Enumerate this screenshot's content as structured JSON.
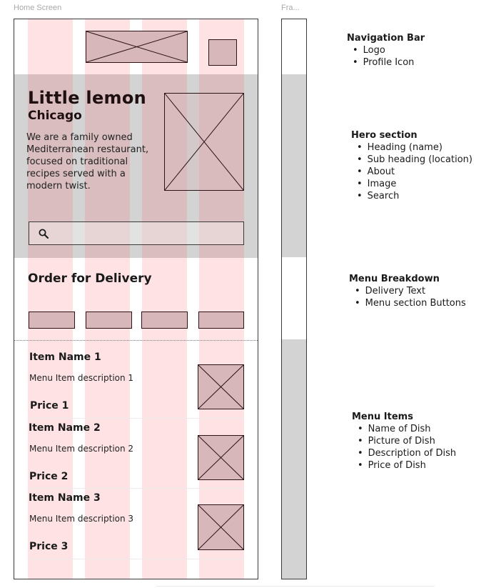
{
  "frames": {
    "home_label": "Home Screen",
    "second_label": "Fra..."
  },
  "hero": {
    "title": "Little lemon",
    "subtitle": "Chicago",
    "about": "We are a family owned Mediterranean restaurant, focused on traditional recipes served with a modern twist.",
    "search_icon": "search-icon"
  },
  "order": {
    "title": "Order for Delivery",
    "button_count_visible": 4
  },
  "menu_items": [
    {
      "name": "Item Name 1",
      "description": "Menu Item description 1",
      "price": "Price 1"
    },
    {
      "name": "Item Name 2",
      "description": "Menu Item description 2",
      "price": "Price 2"
    },
    {
      "name": "Item Name 3",
      "description": "Menu Item description 3",
      "price": "Price 3"
    }
  ],
  "annotations": [
    {
      "heading": "Navigation Bar",
      "items": [
        "Logo",
        "Profile Icon"
      ]
    },
    {
      "heading": "Hero section",
      "items": [
        "Heading (name)",
        "Sub heading (location)",
        "About",
        "Image",
        "Search"
      ]
    },
    {
      "heading": "Menu Breakdown",
      "items": [
        "Delivery Text",
        "Menu section Buttons"
      ]
    },
    {
      "heading": "Menu Items",
      "items": [
        "Name of Dish",
        "Picture of Dish",
        "Description of Dish",
        "Price of Dish"
      ]
    }
  ],
  "colors": {
    "grid_column": "#ffd6d8",
    "wireframe_fill": "#d8b7ba",
    "section_gray": "#d3d3d3",
    "stroke": "#2b1316"
  }
}
